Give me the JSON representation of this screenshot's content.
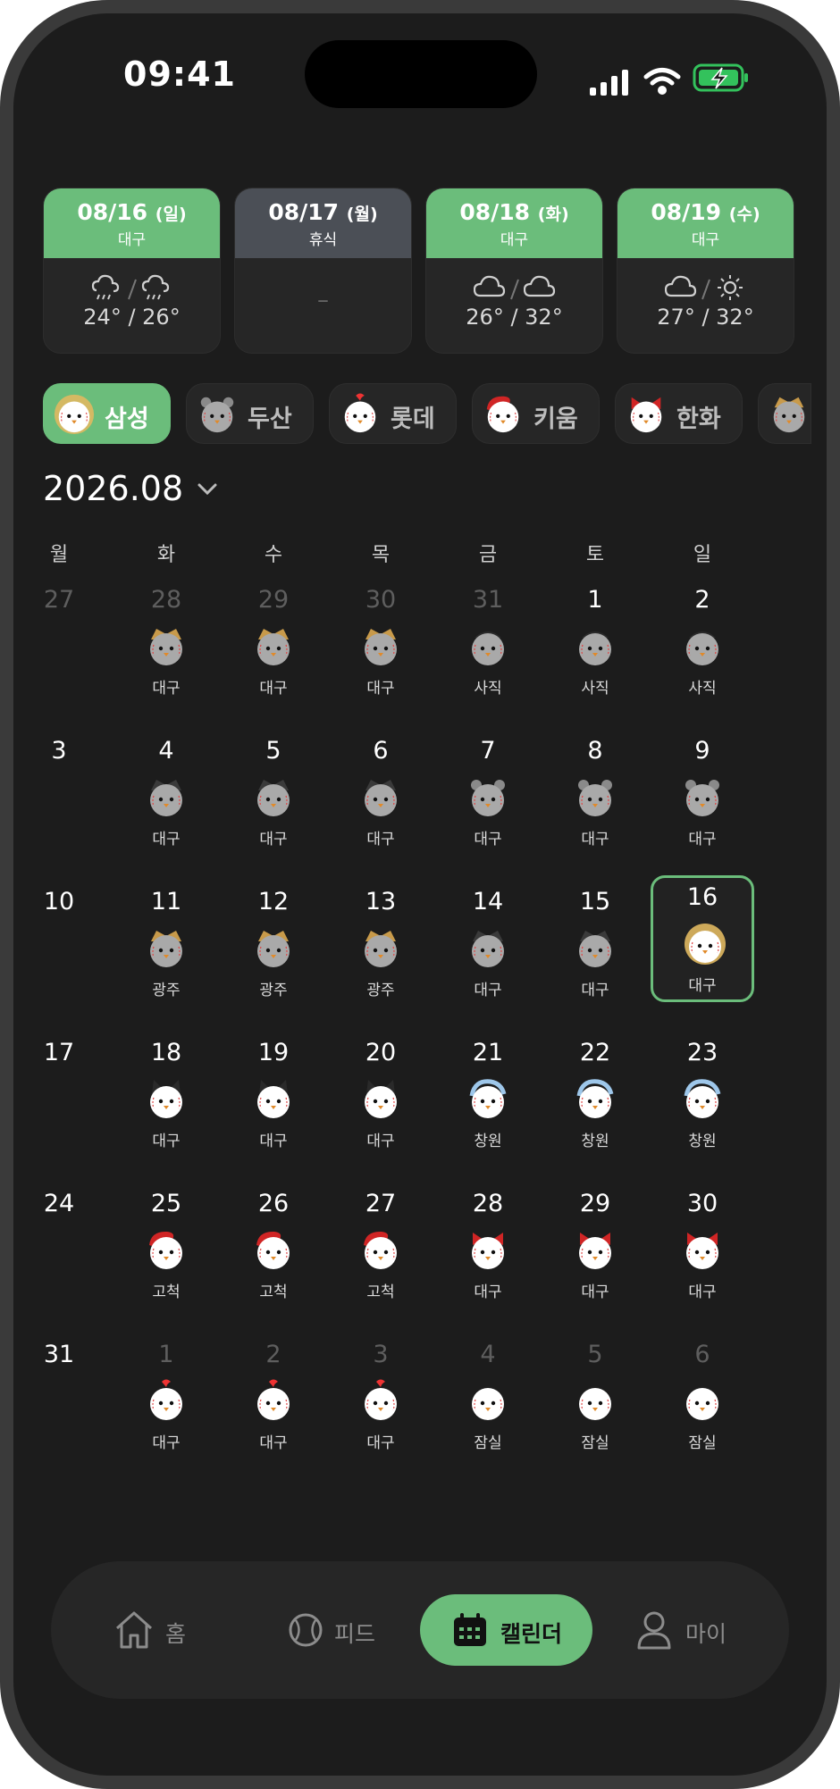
{
  "status": {
    "time": "09:41"
  },
  "weather": [
    {
      "date": "08/16",
      "dow": "(일)",
      "place": "대구",
      "temp": "24° / 26°",
      "icon": "rain-icon",
      "rest": false
    },
    {
      "date": "08/17",
      "dow": "(월)",
      "place": "휴식",
      "temp": "–",
      "icon": "",
      "rest": true
    },
    {
      "date": "08/18",
      "dow": "(화)",
      "place": "대구",
      "temp": "26° / 32°",
      "icon": "cloud-icon",
      "rest": false
    },
    {
      "date": "08/19",
      "dow": "(수)",
      "place": "대구",
      "temp": "27° / 32°",
      "icon": "cloud-sun-icon",
      "rest": false
    }
  ],
  "teams": [
    "삼성",
    "두산",
    "롯데",
    "키움",
    "한화"
  ],
  "month": "2026.08",
  "weekdays": [
    "월",
    "화",
    "수",
    "목",
    "금",
    "토",
    "일"
  ],
  "colors": {
    "accent": "#6bbd7b",
    "background": "#1c1c1c",
    "card": "#262626"
  },
  "days": [
    {
      "n": "27",
      "dim": true,
      "p": ""
    },
    {
      "n": "28",
      "dim": true,
      "p": "대구",
      "m": "tiger"
    },
    {
      "n": "29",
      "dim": true,
      "p": "대구",
      "m": "tiger"
    },
    {
      "n": "30",
      "dim": true,
      "p": "대구",
      "m": "tiger"
    },
    {
      "n": "31",
      "dim": true,
      "p": "사직",
      "m": "gull"
    },
    {
      "n": "1",
      "p": "사직",
      "m": "gull"
    },
    {
      "n": "2",
      "p": "사직",
      "m": "gull"
    },
    {
      "n": "3",
      "p": ""
    },
    {
      "n": "4",
      "p": "대구",
      "m": "eagle"
    },
    {
      "n": "5",
      "p": "대구",
      "m": "eagle"
    },
    {
      "n": "6",
      "p": "대구",
      "m": "eagle"
    },
    {
      "n": "7",
      "p": "대구",
      "m": "bear"
    },
    {
      "n": "8",
      "p": "대구",
      "m": "bear"
    },
    {
      "n": "9",
      "p": "대구",
      "m": "bear"
    },
    {
      "n": "10",
      "p": ""
    },
    {
      "n": "11",
      "p": "광주",
      "m": "tiger"
    },
    {
      "n": "12",
      "p": "광주",
      "m": "tiger"
    },
    {
      "n": "13",
      "p": "광주",
      "m": "tiger"
    },
    {
      "n": "14",
      "p": "대구",
      "m": "eagle"
    },
    {
      "n": "15",
      "p": "대구",
      "m": "eagle"
    },
    {
      "n": "16",
      "p": "대구",
      "m": "lion",
      "today": true
    },
    {
      "n": "17",
      "p": ""
    },
    {
      "n": "18",
      "p": "대구",
      "m": "cat"
    },
    {
      "n": "19",
      "p": "대구",
      "m": "cat"
    },
    {
      "n": "20",
      "p": "대구",
      "m": "cat"
    },
    {
      "n": "21",
      "p": "창원",
      "m": "dino"
    },
    {
      "n": "22",
      "p": "창원",
      "m": "dino"
    },
    {
      "n": "23",
      "p": "창원",
      "m": "dino"
    },
    {
      "n": "24",
      "p": ""
    },
    {
      "n": "25",
      "p": "고척",
      "m": "hero"
    },
    {
      "n": "26",
      "p": "고척",
      "m": "hero"
    },
    {
      "n": "27",
      "p": "고척",
      "m": "hero"
    },
    {
      "n": "28",
      "p": "대구",
      "m": "bow"
    },
    {
      "n": "29",
      "p": "대구",
      "m": "bow"
    },
    {
      "n": "30",
      "p": "대구",
      "m": "bow"
    },
    {
      "n": "31",
      "p": ""
    },
    {
      "n": "1",
      "dim": true,
      "p": "대구",
      "m": "chick"
    },
    {
      "n": "2",
      "dim": true,
      "p": "대구",
      "m": "chick"
    },
    {
      "n": "3",
      "dim": true,
      "p": "대구",
      "m": "chick"
    },
    {
      "n": "4",
      "dim": true,
      "p": "잠실",
      "m": "twin"
    },
    {
      "n": "5",
      "dim": true,
      "p": "잠실",
      "m": "twin"
    },
    {
      "n": "6",
      "dim": true,
      "p": "잠실",
      "m": "twin"
    }
  ],
  "nav": [
    {
      "label": "홈",
      "icon": "home-icon"
    },
    {
      "label": "피드",
      "icon": "baseball-icon"
    },
    {
      "label": "캘린더",
      "icon": "calendar-icon",
      "active": true
    },
    {
      "label": "마이",
      "icon": "user-icon"
    }
  ]
}
